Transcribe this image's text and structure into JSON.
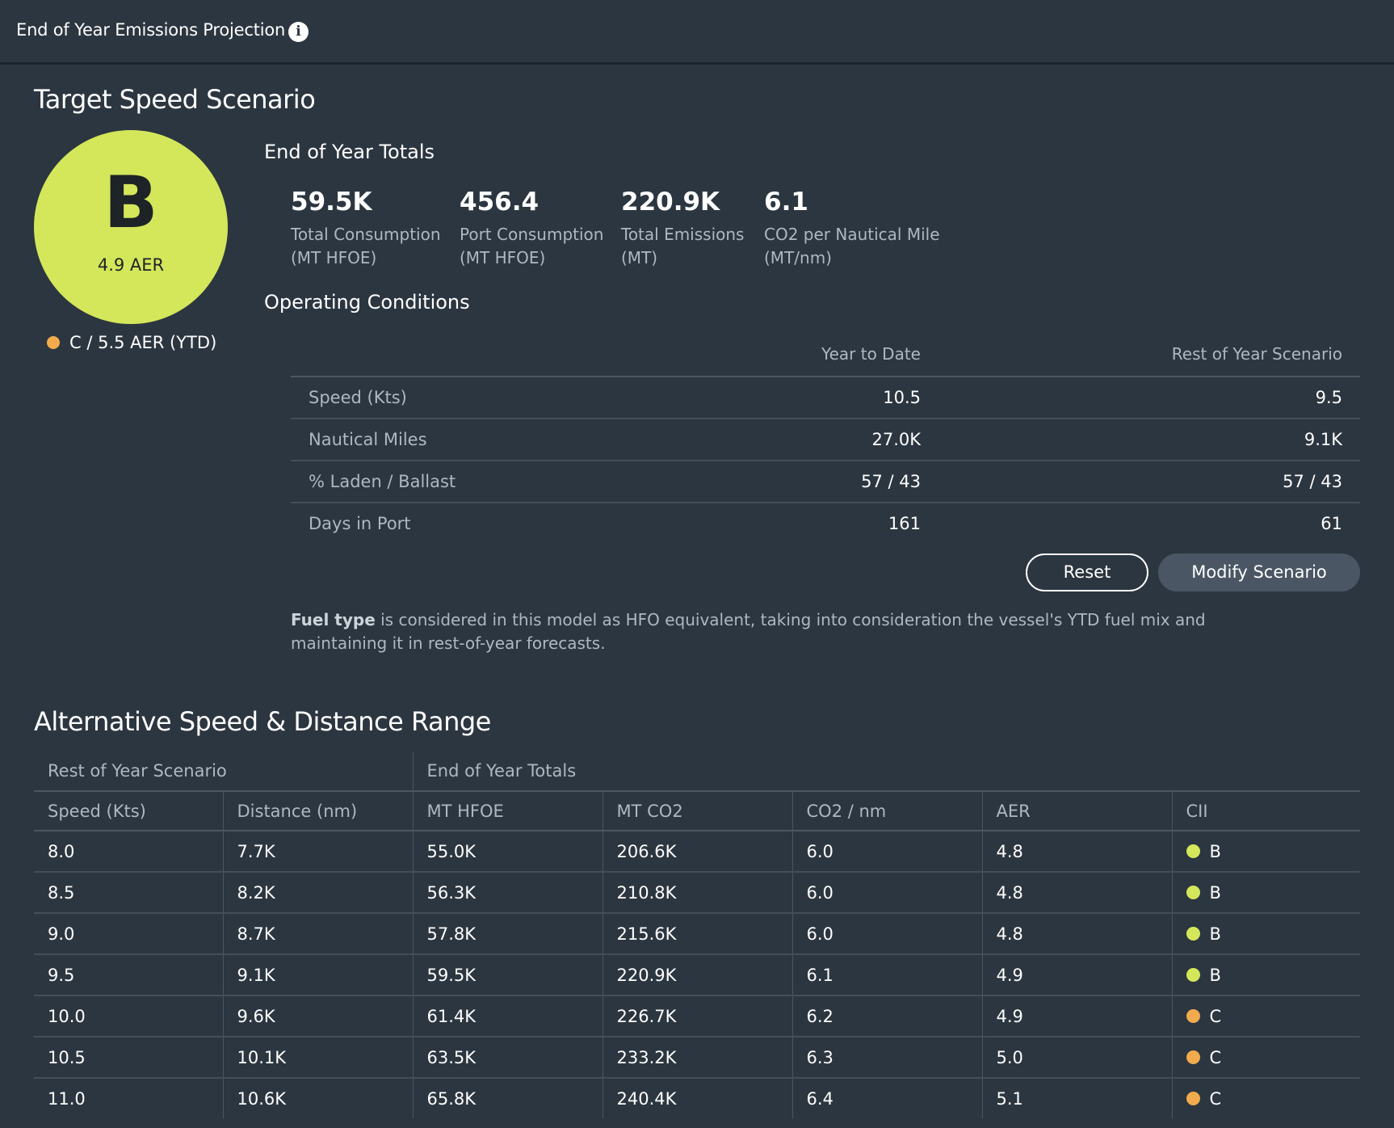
{
  "header": {
    "title": "End of Year Emissions Projection",
    "info_icon": "info-icon"
  },
  "colors": {
    "grade_b": "#d4e75a",
    "grade_c": "#f2ab4c",
    "background": "#2b3640"
  },
  "scenario": {
    "title": "Target Speed Scenario",
    "grade": {
      "letter": "B",
      "aer": "4.9 AER",
      "color": "#d4e75a"
    },
    "ytd": {
      "text": "C / 5.5 AER (YTD)",
      "color": "#f2ab4c"
    },
    "totals": {
      "title": "End of Year Totals",
      "items": [
        {
          "value": "59.5K",
          "label": "Total Consumption",
          "unit": "(MT HFOE)"
        },
        {
          "value": "456.4",
          "label": "Port Consumption",
          "unit": "(MT HFOE)"
        },
        {
          "value": "220.9K",
          "label": "Total Emissions",
          "unit": "(MT)"
        },
        {
          "value": "6.1",
          "label": "CO2 per Nautical Mile",
          "unit": "(MT/nm)"
        }
      ]
    },
    "operating": {
      "title": "Operating Conditions",
      "columns": [
        "Year to Date",
        "Rest of Year Scenario"
      ],
      "rows": [
        {
          "label": "Speed (Kts)",
          "ytd": "10.5",
          "roy": "9.5"
        },
        {
          "label": "Nautical Miles",
          "ytd": "27.0K",
          "roy": "9.1K"
        },
        {
          "label": "% Laden / Ballast",
          "ytd": "57 / 43",
          "roy": "57 / 43"
        },
        {
          "label": "Days in Port",
          "ytd": "161",
          "roy": "61"
        }
      ]
    },
    "buttons": {
      "reset": "Reset",
      "modify": "Modify Scenario"
    },
    "note": {
      "bold": "Fuel type",
      "text": " is considered in this model as HFO equivalent, taking into consideration the vessel's YTD fuel mix and maintaining it in rest-of-year forecasts."
    }
  },
  "alternative": {
    "title": "Alternative Speed & Distance Range",
    "groups": [
      "Rest of Year Scenario",
      "End of Year Totals"
    ],
    "columns": [
      "Speed (Kts)",
      "Distance (nm)",
      "MT HFOE",
      "MT CO2",
      "CO2 / nm",
      "AER",
      "CII"
    ],
    "rows": [
      {
        "speed": "8.0",
        "distance": "7.7K",
        "hfoe": "55.0K",
        "co2": "206.6K",
        "co2nm": "6.0",
        "aer": "4.8",
        "cii": "B",
        "cii_color": "#d4e75a"
      },
      {
        "speed": "8.5",
        "distance": "8.2K",
        "hfoe": "56.3K",
        "co2": "210.8K",
        "co2nm": "6.0",
        "aer": "4.8",
        "cii": "B",
        "cii_color": "#d4e75a"
      },
      {
        "speed": "9.0",
        "distance": "8.7K",
        "hfoe": "57.8K",
        "co2": "215.6K",
        "co2nm": "6.0",
        "aer": "4.8",
        "cii": "B",
        "cii_color": "#d4e75a"
      },
      {
        "speed": "9.5",
        "distance": "9.1K",
        "hfoe": "59.5K",
        "co2": "220.9K",
        "co2nm": "6.1",
        "aer": "4.9",
        "cii": "B",
        "cii_color": "#d4e75a"
      },
      {
        "speed": "10.0",
        "distance": "9.6K",
        "hfoe": "61.4K",
        "co2": "226.7K",
        "co2nm": "6.2",
        "aer": "4.9",
        "cii": "C",
        "cii_color": "#f2ab4c"
      },
      {
        "speed": "10.5",
        "distance": "10.1K",
        "hfoe": "63.5K",
        "co2": "233.2K",
        "co2nm": "6.3",
        "aer": "5.0",
        "cii": "C",
        "cii_color": "#f2ab4c"
      },
      {
        "speed": "11.0",
        "distance": "10.6K",
        "hfoe": "65.8K",
        "co2": "240.4K",
        "co2nm": "6.4",
        "aer": "5.1",
        "cii": "C",
        "cii_color": "#f2ab4c"
      }
    ]
  }
}
